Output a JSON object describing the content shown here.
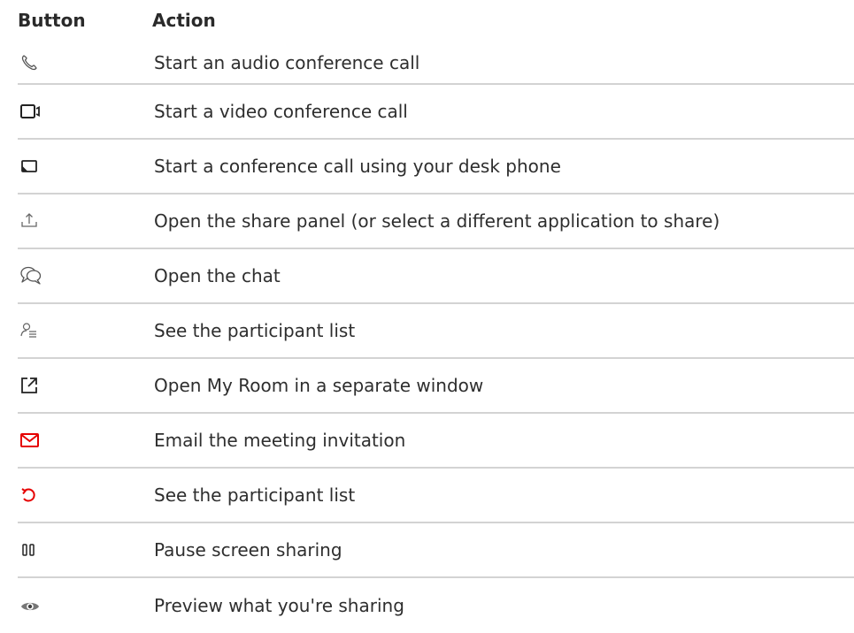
{
  "table": {
    "headers": {
      "button": "Button",
      "action": "Action"
    },
    "rows": [
      {
        "icon": "phone-icon",
        "action": "Start an audio conference call"
      },
      {
        "icon": "video-camera-icon",
        "action": "Start a video conference call"
      },
      {
        "icon": "desk-phone-screen-icon",
        "action": "Start a conference call using your desk phone"
      },
      {
        "icon": "share-upload-icon",
        "action": "Open the share panel (or select a different application to share)"
      },
      {
        "icon": "chat-bubbles-icon",
        "action": "Open the chat"
      },
      {
        "icon": "participant-list-icon",
        "action": "See the participant list"
      },
      {
        "icon": "open-external-window-icon",
        "action": "Open My Room in a separate window"
      },
      {
        "icon": "email-envelope-icon",
        "action": "Email the meeting invitation"
      },
      {
        "icon": "refresh-arrow-icon",
        "action": "See the participant list"
      },
      {
        "icon": "pause-icon",
        "action": "Pause screen sharing"
      },
      {
        "icon": "eye-preview-icon",
        "action": "Preview what you're sharing"
      }
    ]
  },
  "colors": {
    "text": "#2e2e2e",
    "icon_gray": "#555555",
    "icon_red": "#e60000",
    "divider": "#d3d3d3"
  }
}
